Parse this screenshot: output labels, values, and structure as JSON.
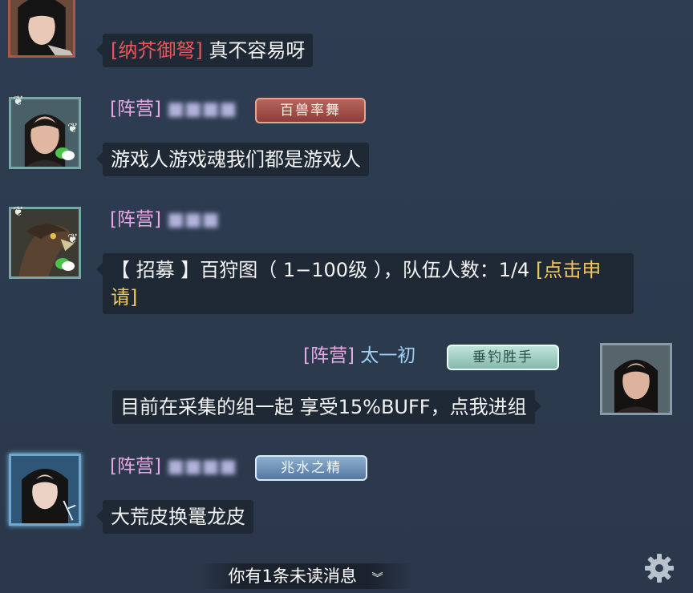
{
  "messages": [
    {
      "avatar_icon": "female-character-portrait-icon",
      "name": "[纳芥御弩]",
      "text": "真不容易呀"
    },
    {
      "avatar_icon": "male-character-portrait-icon",
      "camp": "[阵营]",
      "title_badge": "百兽率舞",
      "text": "游戏人游戏魂我们都是游戏人"
    },
    {
      "avatar_icon": "eagle-portrait-icon",
      "camp": "[阵营]",
      "text_prefix": "【 招募 】百狩图（ 1−100级 ），队伍人数：1/4 ",
      "text_link": "[点击申请]"
    },
    {
      "avatar_icon": "self-male-portrait-icon",
      "camp": "[阵营]",
      "name": "太一初",
      "title_badge": "垂钓胜手",
      "text": "目前在采集的组一起 享受15%BUFF，点我进组"
    },
    {
      "avatar_icon": "female-portrait-icon",
      "camp": "[阵营]",
      "title_badge": "兆水之精",
      "text": "大荒皮换鼍龙皮"
    }
  ],
  "unread_notice": {
    "text": "你有1条未读消息",
    "icon": "double-chevron-down-icon"
  },
  "settings": {
    "icon": "gear-icon"
  },
  "colors": {
    "camp": "#e7a8e3",
    "link": "#f0c75a",
    "self_name": "#9ed0f2",
    "bubble": "#1f2936",
    "background": "#2e3c50"
  }
}
